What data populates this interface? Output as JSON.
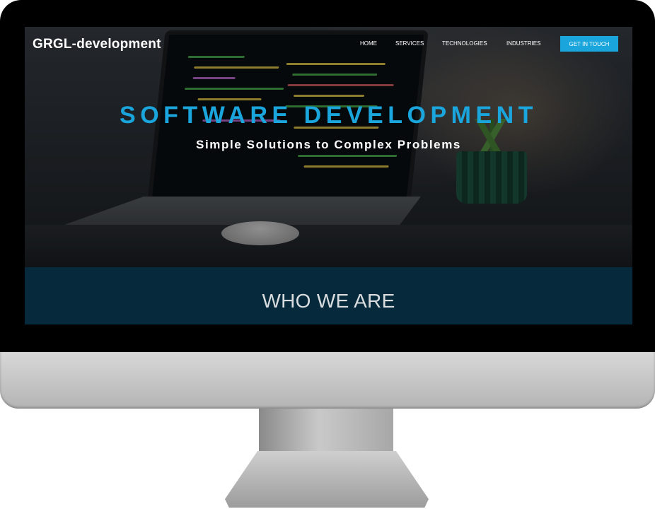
{
  "site": {
    "brand": "GRGL-development"
  },
  "nav": {
    "items": [
      {
        "label": "HOME"
      },
      {
        "label": "SERVICES"
      },
      {
        "label": "TECHNOLOGIES"
      },
      {
        "label": "INDUSTRIES"
      }
    ],
    "cta_label": "GET IN TOUCH"
  },
  "hero": {
    "headline": "SOFTWARE DEVELOPMENT",
    "subheadline": "Simple Solutions to Complex Problems"
  },
  "about": {
    "title": "WHO WE ARE"
  },
  "colors": {
    "accent": "#1aa6dc",
    "band": "#062a3b",
    "bezel": "#000000"
  }
}
